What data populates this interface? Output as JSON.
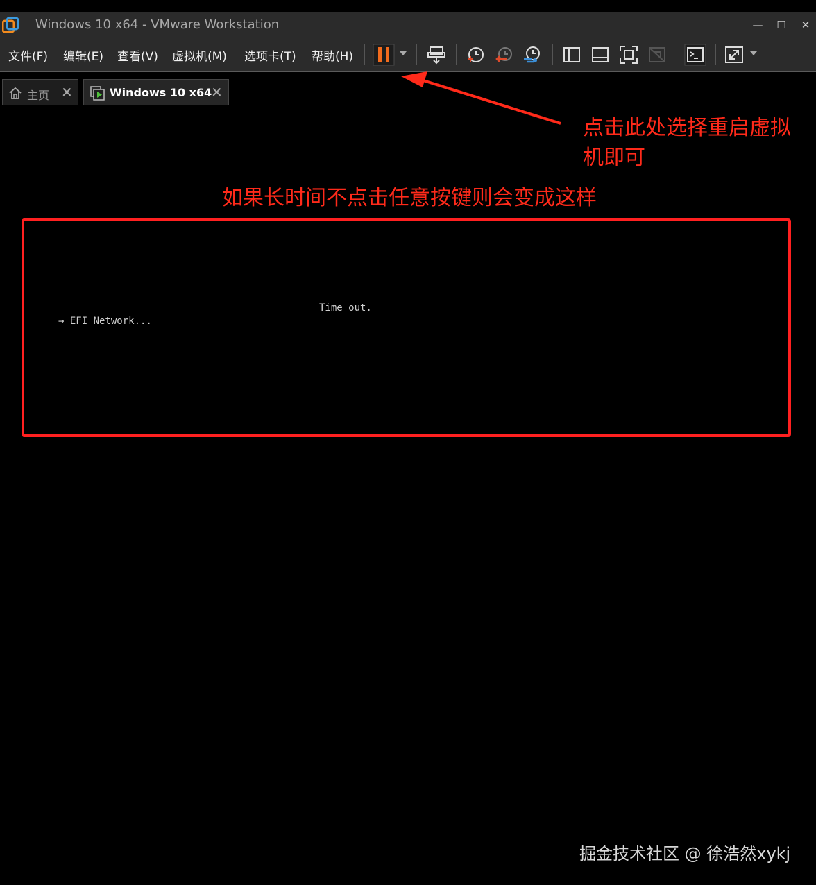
{
  "window": {
    "title": "Windows 10 x64 - VMware Workstation",
    "minimize_glyph": "—",
    "maximize_glyph": "☐",
    "close_glyph": "✕"
  },
  "menu": {
    "items": [
      "文件(F)",
      "编辑(E)",
      "查看(V)",
      "虚拟机(M)",
      "选项卡(T)",
      "帮助(H)"
    ]
  },
  "toolbar": {
    "icons": [
      "pause-icon",
      "send-ctrl-alt-del-icon",
      "snapshot-icon",
      "revert-snapshot-icon",
      "snapshot-manager-icon",
      "show-library-icon",
      "thumbnail-bar-icon",
      "fullscreen-icon",
      "unity-icon",
      "console-view-icon",
      "stretch-guest-icon"
    ],
    "colors": {
      "pause": "#f26b1d",
      "accent_red": "#e04a2a",
      "accent_blue": "#3b8fd9"
    }
  },
  "tabs": [
    {
      "label": "主页",
      "icon": "home-icon",
      "active": false
    },
    {
      "label": "Windows 10 x64",
      "icon": "vm-running-icon",
      "active": true
    }
  ],
  "annotations": {
    "arrow_note_line1": "点击此处选择重启虚拟",
    "arrow_note_line2": "机即可",
    "box_note": "如果长时间不点击任意按键则会变成这样",
    "color": "#ff2a1a"
  },
  "console": {
    "line1": "Time out.",
    "line2": "→ EFI Network..."
  },
  "watermark": "掘金技术社区 @ 徐浩然xykj"
}
